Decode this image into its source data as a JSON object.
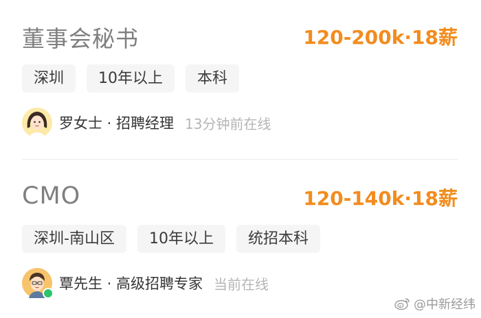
{
  "jobs": [
    {
      "title": "董事会秘书",
      "salary": "120-200k·18薪",
      "tags": [
        "深圳",
        "10年以上",
        "本科"
      ],
      "recruiter": {
        "name_role": "罗女士 · 招聘经理",
        "status": "13分钟前在线",
        "avatar_icon": "female-avatar-icon",
        "online": false
      }
    },
    {
      "title": "CMO",
      "salary": "120-140k·18薪",
      "tags": [
        "深圳-南山区",
        "10年以上",
        "统招本科"
      ],
      "recruiter": {
        "name_role": "覃先生 · 高级招聘专家",
        "status": "当前在线",
        "avatar_icon": "male-avatar-icon",
        "online": true
      }
    }
  ],
  "watermark": {
    "text": "@中新经纬",
    "icon": "weibo-logo-icon"
  },
  "colors": {
    "salary": "#f28c1e",
    "title": "#7f7f7f",
    "tag_bg": "#f5f5f5",
    "online": "#2ec26a"
  }
}
